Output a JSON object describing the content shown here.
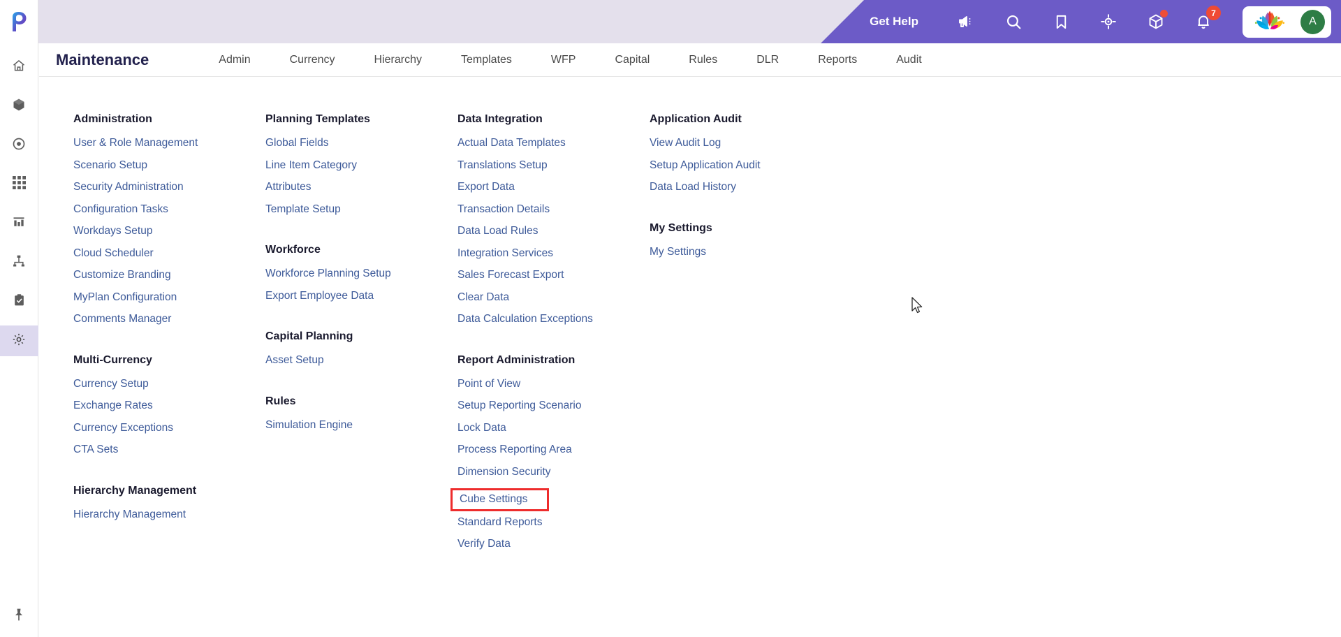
{
  "header": {
    "get_help_label": "Get Help",
    "icons": [
      {
        "name": "megaphone-icon",
        "badge": null
      },
      {
        "name": "search-icon",
        "badge": null
      },
      {
        "name": "bookmark-icon",
        "badge": null
      },
      {
        "name": "target-icon",
        "badge": null
      },
      {
        "name": "cube-icon",
        "badge": "dot"
      },
      {
        "name": "notification-bell-icon",
        "badge": "7"
      }
    ],
    "notification_count": "7",
    "avatar_initial": "A",
    "brand_color": "#6c5bc7",
    "badge_color": "#ef4a34",
    "avatar_color": "#2e7d45"
  },
  "rail": {
    "logo": "planful-logo-icon",
    "items": [
      {
        "name": "home-icon",
        "active": false
      },
      {
        "name": "package-icon",
        "active": false
      },
      {
        "name": "target-circle-icon",
        "active": false
      },
      {
        "name": "grid-icon",
        "active": false
      },
      {
        "name": "chart-icon",
        "active": false
      },
      {
        "name": "hierarchy-icon",
        "active": false
      },
      {
        "name": "clipboard-check-icon",
        "active": false
      },
      {
        "name": "gear-icon",
        "active": true
      }
    ],
    "bottom": {
      "name": "pin-icon"
    }
  },
  "nav": {
    "page_title": "Maintenance",
    "tabs": [
      {
        "label": "Admin"
      },
      {
        "label": "Currency"
      },
      {
        "label": "Hierarchy"
      },
      {
        "label": "Templates"
      },
      {
        "label": "WFP"
      },
      {
        "label": "Capital"
      },
      {
        "label": "Rules"
      },
      {
        "label": "DLR"
      },
      {
        "label": "Reports"
      },
      {
        "label": "Audit"
      }
    ]
  },
  "menu": {
    "highlight_color": "#ee2c2c",
    "highlighted_item": "Cube Settings",
    "columns": [
      {
        "groups": [
          {
            "title": "Administration",
            "links": [
              "User & Role Management",
              "Scenario Setup",
              "Security Administration",
              "Configuration Tasks",
              "Workdays Setup",
              "Cloud Scheduler",
              "Customize Branding",
              "MyPlan Configuration",
              "Comments Manager"
            ]
          },
          {
            "title": "Multi-Currency",
            "links": [
              "Currency Setup",
              "Exchange Rates",
              "Currency Exceptions",
              "CTA Sets"
            ]
          },
          {
            "title": "Hierarchy Management",
            "links": [
              "Hierarchy Management"
            ]
          }
        ]
      },
      {
        "groups": [
          {
            "title": "Planning Templates",
            "links": [
              "Global Fields",
              "Line Item Category",
              "Attributes",
              "Template Setup"
            ]
          },
          {
            "title": "Workforce",
            "links": [
              "Workforce Planning Setup",
              "Export Employee Data"
            ]
          },
          {
            "title": "Capital Planning",
            "links": [
              "Asset Setup"
            ]
          },
          {
            "title": "Rules",
            "links": [
              "Simulation Engine"
            ]
          }
        ]
      },
      {
        "groups": [
          {
            "title": "Data Integration",
            "links": [
              "Actual Data Templates",
              "Translations Setup",
              "Export Data",
              "Transaction Details",
              "Data Load Rules",
              "Integration Services",
              "Sales Forecast Export",
              "Clear Data",
              "Data Calculation Exceptions"
            ]
          },
          {
            "title": "Report Administration",
            "links": [
              "Point of View",
              "Setup Reporting Scenario",
              "Lock Data",
              "Process Reporting Area",
              "Dimension Security",
              "Cube Settings",
              "Standard Reports",
              "Verify Data"
            ]
          }
        ]
      },
      {
        "groups": [
          {
            "title": "Application Audit",
            "links": [
              "View Audit Log",
              "Setup Application Audit",
              "Data Load History"
            ]
          },
          {
            "title": "My Settings",
            "links": [
              "My Settings"
            ]
          }
        ]
      }
    ]
  }
}
